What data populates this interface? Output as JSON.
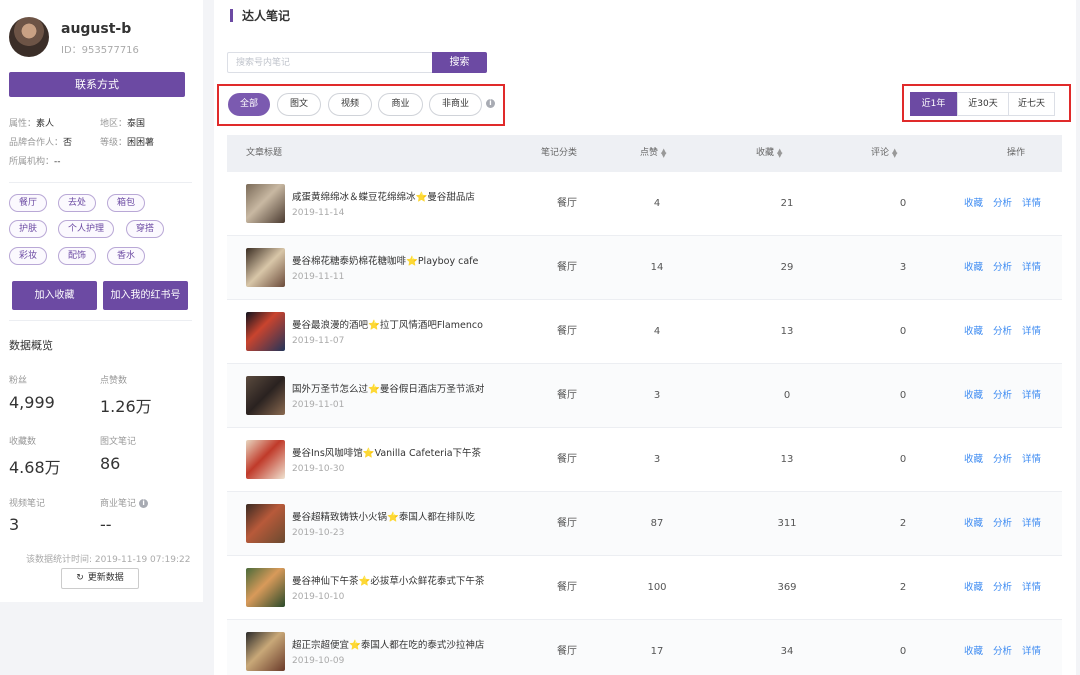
{
  "profile": {
    "name": "august-b",
    "id": "ID：953577716",
    "contact_button": "联系方式",
    "attributes": [
      {
        "label": "属性：",
        "value": "素人"
      },
      {
        "label": "地区：",
        "value": "泰国"
      },
      {
        "label": "品牌合作人：",
        "value": "否"
      },
      {
        "label": "等级：",
        "value": "困困薯"
      },
      {
        "label": "所属机构：",
        "value": "--"
      }
    ],
    "tags": [
      "餐厅",
      "去处",
      "箱包",
      "护肤",
      "个人护理",
      "穿搭",
      "彩妆",
      "配饰",
      "香水"
    ],
    "add_favorite_button": "加入收藏",
    "add_account_button": "加入我的红书号"
  },
  "overview": {
    "title": "数据概览",
    "stats": [
      {
        "label": "粉丝",
        "value": "4,999"
      },
      {
        "label": "点赞数",
        "value": "1.26万"
      },
      {
        "label": "收藏数",
        "value": "4.68万"
      },
      {
        "label": "图文笔记",
        "value": "86"
      },
      {
        "label": "视频笔记",
        "value": "3"
      },
      {
        "label": "商业笔记",
        "value": "--"
      }
    ],
    "update_time": "该数据统计时间: 2019-11-19 07:19:22",
    "update_button": "更新数据"
  },
  "main": {
    "title": "达人笔记",
    "search_placeholder": "搜索号内笔记",
    "search_button": "搜索",
    "filters": [
      "全部",
      "图文",
      "视频",
      "商业",
      "非商业"
    ],
    "info_glyph": "i",
    "time_ranges": [
      "近1年",
      "近30天",
      "近七天"
    ]
  },
  "table": {
    "headers": [
      "文章标题",
      "笔记分类",
      "点赞",
      "收藏",
      "评论",
      "操作"
    ],
    "actions": [
      "收藏",
      "分析",
      "详情"
    ],
    "rows": [
      {
        "title": "咸蛋黄绵绵冰＆蝶豆花绵绵冰⭐曼谷甜品店",
        "date": "2019-11-14",
        "category": "餐厅",
        "likes": "4",
        "favorites": "21",
        "comments": "0"
      },
      {
        "title": "曼谷棉花糖泰奶棉花糖咖啡⭐Playboy cafe",
        "date": "2019-11-11",
        "category": "餐厅",
        "likes": "14",
        "favorites": "29",
        "comments": "3"
      },
      {
        "title": "曼谷最浪漫的酒吧⭐拉丁风情酒吧Flamenco",
        "date": "2019-11-07",
        "category": "餐厅",
        "likes": "4",
        "favorites": "13",
        "comments": "0"
      },
      {
        "title": "国外万圣节怎么过⭐曼谷假日酒店万圣节派对",
        "date": "2019-11-01",
        "category": "餐厅",
        "likes": "3",
        "favorites": "0",
        "comments": "0"
      },
      {
        "title": "曼谷Ins风咖啡馆⭐Vanilla Cafeteria下午茶",
        "date": "2019-10-30",
        "category": "餐厅",
        "likes": "3",
        "favorites": "13",
        "comments": "0"
      },
      {
        "title": "曼谷超精致铸铁小火锅⭐泰国人都在排队吃",
        "date": "2019-10-23",
        "category": "餐厅",
        "likes": "87",
        "favorites": "311",
        "comments": "2"
      },
      {
        "title": "曼谷神仙下午茶⭐必拔草小众鲜花泰式下午茶",
        "date": "2019-10-10",
        "category": "餐厅",
        "likes": "100",
        "favorites": "369",
        "comments": "2"
      },
      {
        "title": "超正宗超便宜⭐泰国人都在吃的泰式沙拉神店",
        "date": "2019-10-09",
        "category": "餐厅",
        "likes": "17",
        "favorites": "34",
        "comments": "0"
      }
    ]
  },
  "colors": {
    "accent": "#6c4aa3",
    "link": "#3d8bf2",
    "highlight_box": "#e02a2a"
  }
}
